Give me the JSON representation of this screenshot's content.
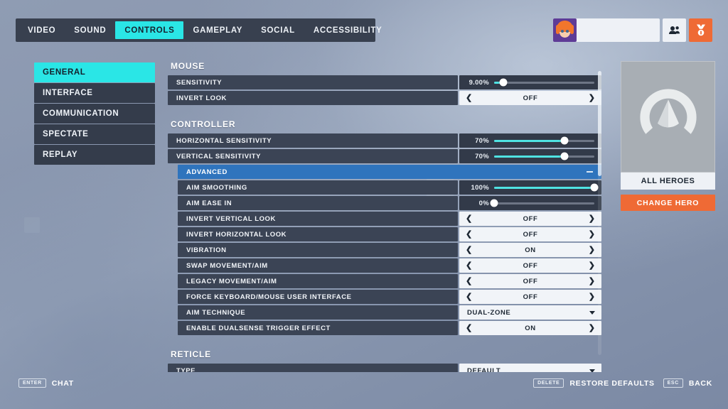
{
  "nav": {
    "tabs": [
      {
        "label": "VIDEO",
        "active": false
      },
      {
        "label": "SOUND",
        "active": false
      },
      {
        "label": "CONTROLS",
        "active": true
      },
      {
        "label": "GAMEPLAY",
        "active": false
      },
      {
        "label": "SOCIAL",
        "active": false
      },
      {
        "label": "ACCESSIBILITY",
        "active": false
      }
    ]
  },
  "profile": {
    "player_name": "",
    "avatar_icon": "player-portrait",
    "social_icon": "group-icon",
    "badge_icon": "owl-token-icon"
  },
  "sidebar": {
    "items": [
      {
        "label": "GENERAL",
        "active": true
      },
      {
        "label": "INTERFACE",
        "active": false
      },
      {
        "label": "COMMUNICATION",
        "active": false
      },
      {
        "label": "SPECTATE",
        "active": false
      },
      {
        "label": "REPLAY",
        "active": false
      }
    ]
  },
  "sections": [
    {
      "title": "MOUSE",
      "rows": [
        {
          "label": "SENSITIVITY",
          "type": "slider",
          "value": "9.00%",
          "percent": 9
        },
        {
          "label": "INVERT LOOK",
          "type": "toggle",
          "value": "OFF"
        }
      ]
    },
    {
      "title": "CONTROLLER",
      "rows": [
        {
          "label": "HORIZONTAL SENSITIVITY",
          "type": "slider",
          "value": "70%",
          "percent": 70
        },
        {
          "label": "VERTICAL SENSITIVITY",
          "type": "slider",
          "value": "70%",
          "percent": 70
        },
        {
          "label": "ADVANCED",
          "type": "group",
          "state": "expanded",
          "icon": "minus-icon"
        },
        {
          "label": "AIM SMOOTHING",
          "type": "slider",
          "value": "100%",
          "percent": 100,
          "indent": true
        },
        {
          "label": "AIM EASE IN",
          "type": "slider",
          "value": "0%",
          "percent": 0,
          "indent": true
        },
        {
          "label": "INVERT VERTICAL LOOK",
          "type": "toggle",
          "value": "OFF",
          "indent": true
        },
        {
          "label": "INVERT HORIZONTAL LOOK",
          "type": "toggle",
          "value": "OFF",
          "indent": true
        },
        {
          "label": "VIBRATION",
          "type": "toggle",
          "value": "ON",
          "indent": true
        },
        {
          "label": "SWAP MOVEMENT/AIM",
          "type": "toggle",
          "value": "OFF",
          "indent": true
        },
        {
          "label": "LEGACY MOVEMENT/AIM",
          "type": "toggle",
          "value": "OFF",
          "indent": true
        },
        {
          "label": "FORCE KEYBOARD/MOUSE USER INTERFACE",
          "type": "toggle",
          "value": "OFF",
          "indent": true
        },
        {
          "label": "AIM TECHNIQUE",
          "type": "dropdown",
          "value": "DUAL-ZONE",
          "indent": true
        },
        {
          "label": "ENABLE DUALSENSE TRIGGER EFFECT",
          "type": "toggle",
          "value": "ON",
          "indent": true
        }
      ]
    },
    {
      "title": "RETICLE",
      "rows": [
        {
          "label": "TYPE",
          "type": "dropdown",
          "value": "DEFAULT"
        }
      ]
    }
  ],
  "hero_panel": {
    "logo_icon": "overwatch-logo-icon",
    "hero_name": "ALL HEROES",
    "change_hero_label": "CHANGE HERO"
  },
  "footer": {
    "left": [
      {
        "key": "ENTER",
        "label": "CHAT"
      }
    ],
    "right": [
      {
        "key": "DELETE",
        "label": "RESTORE DEFAULTS"
      },
      {
        "key": "ESC",
        "label": "BACK"
      }
    ]
  },
  "colors": {
    "accent_cyan": "#2ae6e6",
    "accent_orange": "#ef6a35",
    "group_blue": "#2f74bd",
    "row_dark": "#3b4455",
    "control_light": "#f1f4f8"
  }
}
